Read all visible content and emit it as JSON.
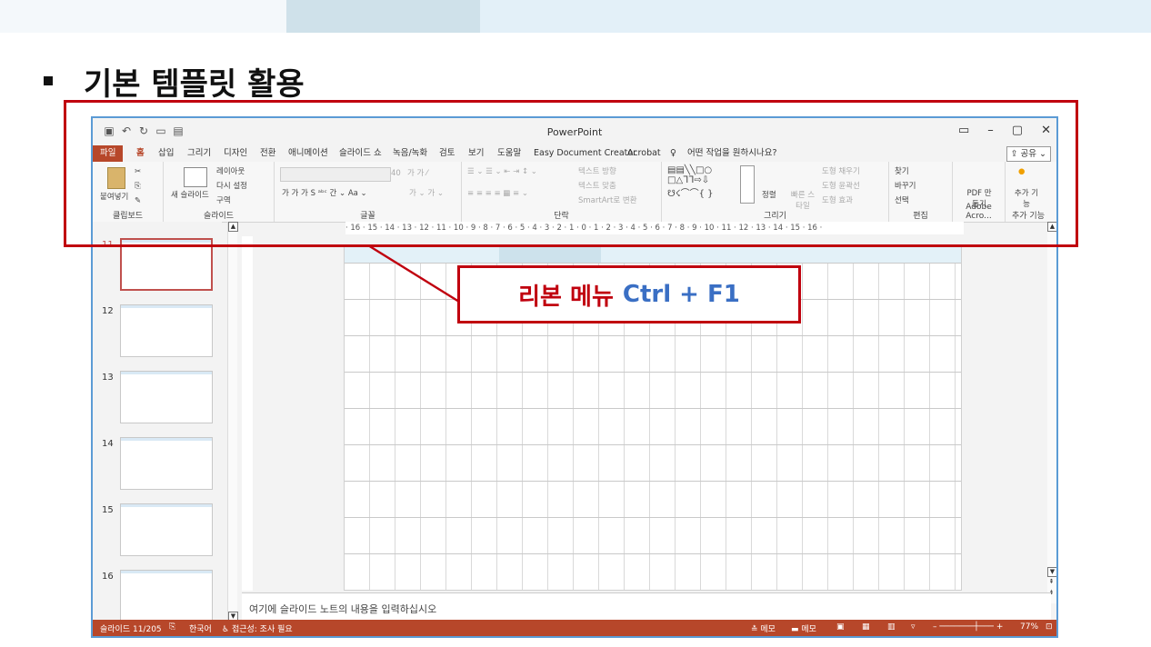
{
  "slide": {
    "title": "기본 템플릿 활용"
  },
  "app": {
    "title": "PowerPoint",
    "qat": [
      "save-icon",
      "undo-icon",
      "redo-icon",
      "present-icon",
      "open-icon"
    ],
    "tabs": [
      "파일",
      "홈",
      "삽입",
      "그리기",
      "디자인",
      "전환",
      "애니메이션",
      "슬라이드 쇼",
      "녹음/녹화",
      "검토",
      "보기",
      "도움말",
      "Easy Document Creator",
      "Acrobat"
    ],
    "tell_me": "어떤 작업을 원하시나요?",
    "share": "공유"
  },
  "ribbon": {
    "clipboard": {
      "label": "클립보드",
      "paste": "붙여넣기"
    },
    "slides": {
      "label": "슬라이드",
      "new_slide": "새 슬라이드",
      "layout": "레이아웃",
      "reset": "다시 설정",
      "section": "구역"
    },
    "font": {
      "label": "글꼴",
      "size": "40"
    },
    "paragraph": {
      "label": "단락",
      "text_direction": "텍스트 방향",
      "align_text": "텍스트 맞춤",
      "smartart": "SmartArt로 변환"
    },
    "drawing": {
      "label": "그리기",
      "arrange": "정렬",
      "quick_styles": "빠른 스타일",
      "shape_fill": "도형 채우기",
      "shape_outline": "도형 윤곽선",
      "shape_effects": "도형 효과"
    },
    "editing": {
      "label": "편집",
      "find": "찾기",
      "replace": "바꾸기",
      "select": "선택"
    },
    "adobe": {
      "label": "Adobe Acro...",
      "pdf": "PDF 만들기"
    },
    "addins": {
      "label": "추가 기능",
      "addins": "추가 기능"
    }
  },
  "ruler": {
    "ticks": "· 16 · 15 · 14 · 13 · 12 · 11 · 10 · 9 · 8 · 7 · 6 · 5 · 4 · 3 · 2 · 1 · 0 · 1 · 2 · 3 · 4 · 5 · 6 · 7 · 8 · 9 · 10 · 11 · 12 · 13 · 14 · 15 · 16 ·"
  },
  "thumbs": [
    "11",
    "12",
    "13",
    "14",
    "15",
    "16"
  ],
  "notes": {
    "placeholder": "여기에 슬라이드 노트의 내용을 입력하십시오"
  },
  "status": {
    "slide": "슬라이드 11/205",
    "lang": "한국어",
    "access": "접근성: 조사 필요",
    "notes": "메모",
    "comments": "메모",
    "zoom": "77%"
  },
  "callout": {
    "korean": "리본 메뉴",
    "shortcut": "Ctrl + F1"
  },
  "colors": {
    "accent": "#b7472a",
    "highlight": "#c0000e",
    "shortcut": "#3a6fc4"
  }
}
